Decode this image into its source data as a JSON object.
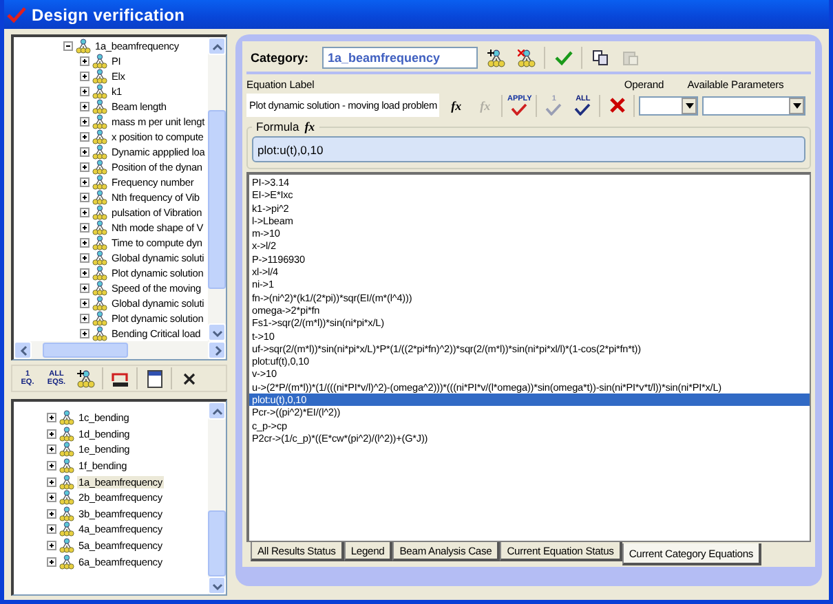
{
  "window": {
    "title": "Design verification"
  },
  "equation_tree": {
    "items": [
      {
        "label": "1a_beamfrequency",
        "expanded": true,
        "children": [
          {
            "label": "PI",
            "expanded": false
          },
          {
            "label": "Elx",
            "expanded": false
          },
          {
            "label": "k1",
            "expanded": false
          },
          {
            "label": "Beam length",
            "expanded": false
          },
          {
            "label": "mass m per unit lengt",
            "expanded": false
          },
          {
            "label": "x position to compute",
            "expanded": false
          },
          {
            "label": "Dynamic appplied loa",
            "expanded": false
          },
          {
            "label": "Position of the dynan",
            "expanded": false
          },
          {
            "label": "Frequency number",
            "expanded": false
          },
          {
            "label": "Nth frequency of Vib",
            "expanded": false
          },
          {
            "label": "pulsation of Vibration",
            "expanded": false
          },
          {
            "label": "Nth mode shape of V",
            "expanded": false
          },
          {
            "label": "Time to compute dyn",
            "expanded": false
          },
          {
            "label": "Global dynamic soluti",
            "expanded": false
          },
          {
            "label": "Plot dynamic solution",
            "expanded": false
          },
          {
            "label": "Speed of the moving",
            "expanded": false
          },
          {
            "label": "Global dynamic soluti",
            "expanded": false
          },
          {
            "label": "Plot dynamic solution",
            "expanded": false
          },
          {
            "label": "Bending Critical load",
            "expanded": false
          }
        ]
      }
    ]
  },
  "tree_toolbar": [
    {
      "kind": "text-icon",
      "lines": [
        "1",
        "EQ."
      ]
    },
    {
      "kind": "text-icon",
      "lines": [
        "ALL",
        "EQS."
      ]
    },
    {
      "kind": "add-node"
    },
    {
      "kind": "loop"
    },
    {
      "kind": "panel"
    },
    {
      "kind": "close"
    }
  ],
  "category_tree": {
    "items": [
      {
        "label": "1c_bending",
        "selected": false
      },
      {
        "label": "1d_bending",
        "selected": false
      },
      {
        "label": "1e_bending",
        "selected": false
      },
      {
        "label": "1f_bending",
        "selected": false
      },
      {
        "label": "1a_beamfrequency",
        "selected": true
      },
      {
        "label": "2b_beamfrequency",
        "selected": false
      },
      {
        "label": "3b_beamfrequency",
        "selected": false
      },
      {
        "label": "4a_beamfrequency",
        "selected": false
      },
      {
        "label": "5a_beamfrequency",
        "selected": false
      },
      {
        "label": "6a_beamfrequency",
        "selected": false
      }
    ]
  },
  "category": {
    "label": "Category:",
    "value": "1a_beamfrequency",
    "toolbar": [
      {
        "kind": "add-node",
        "disabled": false
      },
      {
        "kind": "delete-node",
        "disabled": false
      },
      {
        "kind": "check",
        "disabled": false
      },
      {
        "kind": "copy",
        "disabled": false
      },
      {
        "kind": "paste",
        "disabled": true
      }
    ]
  },
  "equation": {
    "label_header": "Equation Label",
    "operand_header": "Operand",
    "parameters_header": "Available Parameters",
    "label_value": "Plot dynamic solution - moving load problem",
    "toolbar": [
      {
        "kind": "fx-add",
        "label": "fx",
        "disabled": false
      },
      {
        "kind": "fx-remove",
        "label": "fx",
        "disabled": true
      },
      {
        "kind": "apply",
        "label": "APPLY",
        "disabled": false
      },
      {
        "kind": "check-one",
        "label": "1",
        "disabled": true
      },
      {
        "kind": "check-all",
        "label": "ALL",
        "disabled": false
      },
      {
        "kind": "delete",
        "disabled": false
      }
    ]
  },
  "formula": {
    "legend": "Formula",
    "legend_icon": "fx",
    "value": "plot:u(t),0,10"
  },
  "equations": [
    {
      "text": "PI->3.14",
      "selected": false
    },
    {
      "text": "EI->E*Ixc",
      "selected": false
    },
    {
      "text": "k1->pi^2",
      "selected": false
    },
    {
      "text": "l->Lbeam",
      "selected": false
    },
    {
      "text": "m->10",
      "selected": false
    },
    {
      "text": "x->l/2",
      "selected": false
    },
    {
      "text": "P->1196930",
      "selected": false
    },
    {
      "text": "xl->l/4",
      "selected": false
    },
    {
      "text": "ni->1",
      "selected": false
    },
    {
      "text": "fn->(ni^2)*(k1/(2*pi))*sqr(EI/(m*(l^4)))",
      "selected": false
    },
    {
      "text": "omega->2*pi*fn",
      "selected": false
    },
    {
      "text": "Fs1->sqr(2/(m*l))*sin(ni*pi*x/L)",
      "selected": false
    },
    {
      "text": "t->10",
      "selected": false
    },
    {
      "text": "uf->sqr(2/(m*l))*sin(ni*pi*x/L)*P*(1/((2*pi*fn)^2))*sqr(2/(m*l))*sin(ni*pi*xl/l)*(1-cos(2*pi*fn*t))",
      "selected": false
    },
    {
      "text": "plot:uf(t),0,10",
      "selected": false
    },
    {
      "text": "v->10",
      "selected": false
    },
    {
      "text": "u->(2*P/(m*l))*(1/(((ni*PI*v/l)^2)-(omega^2)))*(((ni*PI*v/(l*omega))*sin(omega*t))-sin(ni*PI*v*t/l))*sin(ni*PI*x/L)",
      "selected": false
    },
    {
      "text": "plot:u(t),0,10",
      "selected": true
    },
    {
      "text": "Pcr->((pi^2)*EI/(l^2))",
      "selected": false
    },
    {
      "text": "c_p->cp",
      "selected": false
    },
    {
      "text": "P2cr->(1/c_p)*((E*cw*(pi^2)/(l^2))+(G*J))",
      "selected": false
    }
  ],
  "tabs": [
    {
      "label": "All Results Status",
      "selected": false
    },
    {
      "label": "Legend",
      "selected": false
    },
    {
      "label": "Beam Analysis Case",
      "selected": false
    },
    {
      "label": "Current Equation Status",
      "selected": false
    },
    {
      "label": "Current Category Equations",
      "selected": true
    }
  ]
}
